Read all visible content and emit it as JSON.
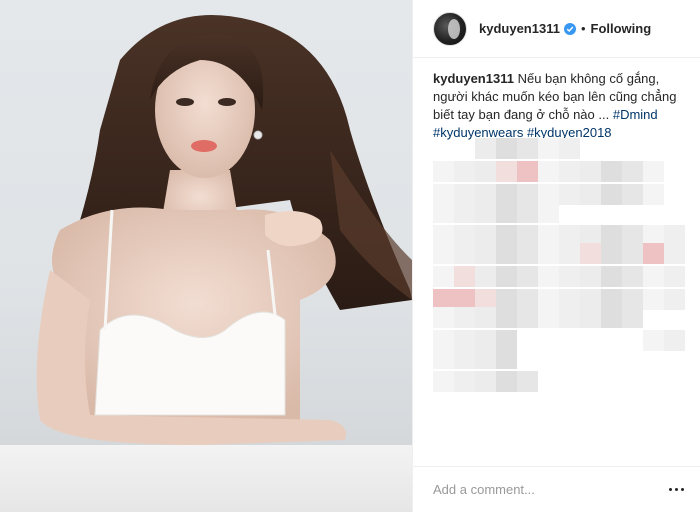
{
  "post": {
    "image_alt": "Portrait photo of a woman in a white camisole",
    "author": {
      "username": "kyduyen1311",
      "verified": true,
      "follow_status": "Following",
      "separator": "•"
    },
    "caption": {
      "username": "kyduyen1311",
      "text": "Nếu bạn không cố gắng, người khác muốn kéo bạn lên cũng chẳng biết tay bạn đang ở chỗ nào ...",
      "hashtags": [
        "#Dmind",
        "#kyduyenwears",
        "#kyduyen2018"
      ]
    },
    "comment_box": {
      "placeholder": "Add a comment..."
    }
  },
  "colors": {
    "link": "#003569",
    "verified_badge": "#3897f0",
    "text": "#262626",
    "placeholder": "#999999"
  },
  "icons": {
    "verified": "verified-badge-icon",
    "more_options": "more-options-icon"
  }
}
